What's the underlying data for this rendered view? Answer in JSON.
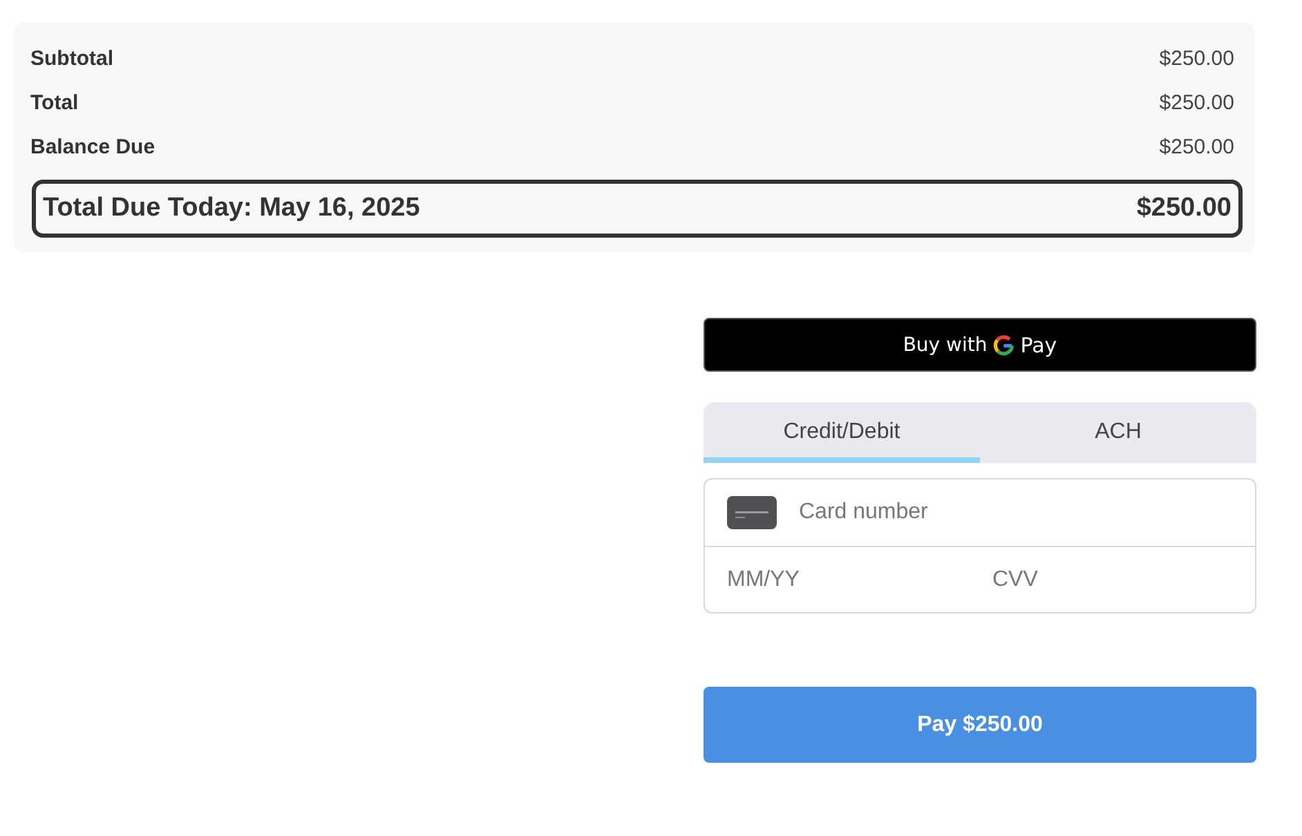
{
  "summary": {
    "rows": [
      {
        "label": "Subtotal",
        "amount": "$250.00"
      },
      {
        "label": "Total",
        "amount": "$250.00"
      },
      {
        "label": "Balance Due",
        "amount": "$250.00"
      }
    ],
    "total_due": {
      "label": "Total Due Today: May 16, 2025",
      "amount": "$250.00"
    }
  },
  "wallet_button": {
    "prefix": "Buy with",
    "suffix": "Pay"
  },
  "tabs": [
    {
      "label": "Credit/Debit",
      "selected": true
    },
    {
      "label": "ACH",
      "selected": false
    }
  ],
  "card_form": {
    "card_number": {
      "placeholder": "Card number"
    },
    "expiry": {
      "placeholder": "MM/YY"
    },
    "cvv": {
      "placeholder": "CVV"
    }
  },
  "pay_button": {
    "label": "Pay $250.00"
  }
}
